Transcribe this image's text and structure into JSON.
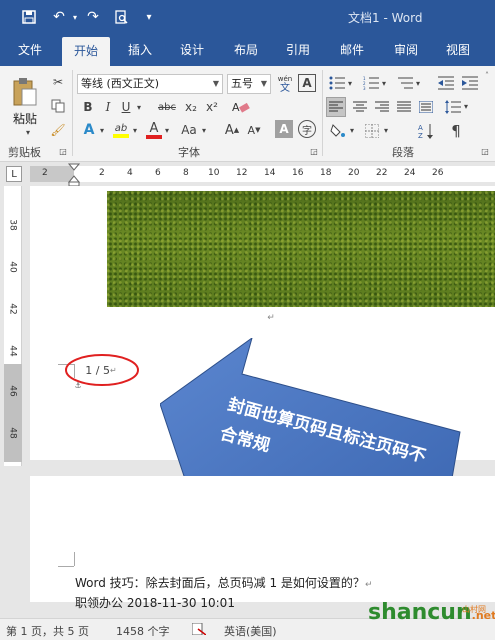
{
  "window": {
    "title": "文档1  -  Word"
  },
  "quick_access": {
    "save_icon": "save-icon",
    "undo_icon": "undo-icon",
    "redo_icon": "redo-icon",
    "preview_icon": "print-preview-icon",
    "customize_icon": "customize-icon"
  },
  "tabs": [
    "文件",
    "开始",
    "插入",
    "设计",
    "布局",
    "引用",
    "邮件",
    "审阅",
    "视图"
  ],
  "ribbon": {
    "clipboard": {
      "paste_label": "粘贴",
      "group_label": "剪贴板"
    },
    "font": {
      "font_name": "等线 (西文正文)",
      "font_size": "五号",
      "wen_label": "wén",
      "wen_char": "文",
      "box_a": "A",
      "bold": "B",
      "italic": "I",
      "underline": "U",
      "strike": "abc",
      "sub": "x₂",
      "sup": "x²",
      "text_effect": "A",
      "highlight": "ab",
      "font_color": "A",
      "change_case": "Aa",
      "grow": "A",
      "shrink": "A",
      "char_shade": "A",
      "enclose": "字",
      "group_label": "字体"
    },
    "paragraph": {
      "group_label": "段落"
    }
  },
  "ruler": {
    "h_labels": [
      "2",
      "2",
      "4",
      "6",
      "8",
      "10",
      "12",
      "14",
      "16",
      "18",
      "20",
      "22",
      "24",
      "26"
    ],
    "v_labels": [
      "38",
      "40",
      "42",
      "44",
      "46",
      "48"
    ]
  },
  "document": {
    "page_number_text": "1 / 5",
    "callout_text": "封面也算页码且标注页码不合常规",
    "body_line1": "Word 技巧：除去封面后，总页码减 1 是如何设置的？",
    "body_line2": "职领办公 2018-11-30 10:01"
  },
  "statusbar": {
    "page": "第 1 页，共 5 页",
    "words": "1458 个字",
    "lang": "英语(美国)"
  },
  "watermark": {
    "text": "shancun",
    "suffix": ".net",
    "cn": "山村网"
  }
}
